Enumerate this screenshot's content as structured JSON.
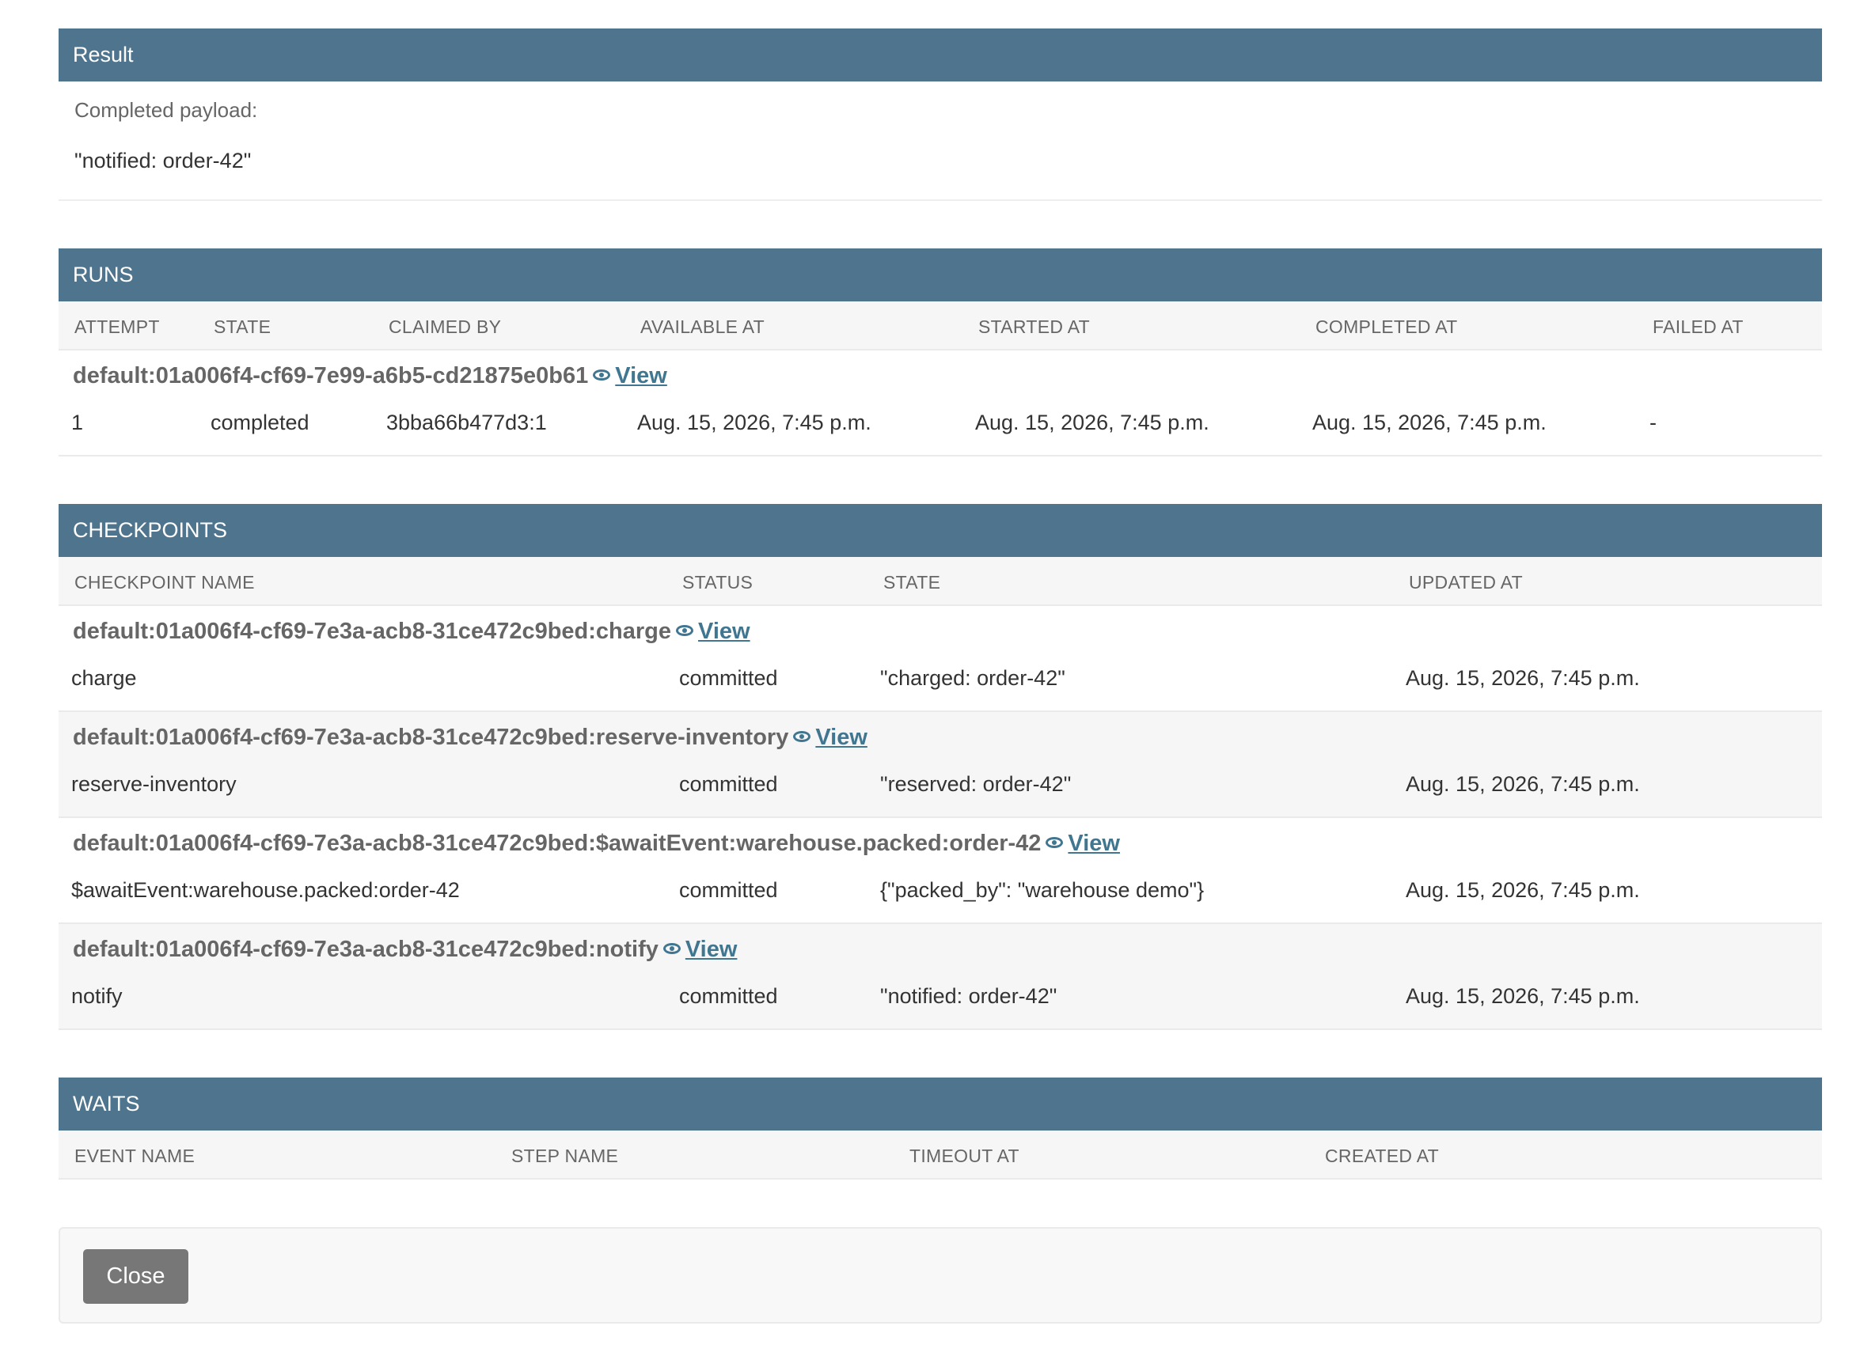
{
  "result": {
    "heading": "Result",
    "label": "Completed payload:",
    "value": "\"notified: order-42\""
  },
  "runs": {
    "heading": "RUNS",
    "columns": [
      "ATTEMPT",
      "STATE",
      "CLAIMED BY",
      "AVAILABLE AT",
      "STARTED AT",
      "COMPLETED AT",
      "FAILED AT"
    ],
    "items": [
      {
        "title": "default:01a006f4-cf69-7e99-a6b5-cd21875e0b61",
        "view_label": "View",
        "attempt": "1",
        "state": "completed",
        "claimed_by": "3bba66b477d3:1",
        "available_at": "Aug. 15, 2026, 7:45 p.m.",
        "started_at": "Aug. 15, 2026, 7:45 p.m.",
        "completed_at": "Aug. 15, 2026, 7:45 p.m.",
        "failed_at": "-"
      }
    ]
  },
  "checkpoints": {
    "heading": "CHECKPOINTS",
    "columns": [
      "CHECKPOINT NAME",
      "STATUS",
      "STATE",
      "UPDATED AT"
    ],
    "items": [
      {
        "title": "default:01a006f4-cf69-7e3a-acb8-31ce472c9bed:charge",
        "view_label": "View",
        "name": "charge",
        "status": "committed",
        "state": "\"charged: order-42\"",
        "updated_at": "Aug. 15, 2026, 7:45 p.m."
      },
      {
        "title": "default:01a006f4-cf69-7e3a-acb8-31ce472c9bed:reserve-inventory",
        "view_label": "View",
        "name": "reserve-inventory",
        "status": "committed",
        "state": "\"reserved: order-42\"",
        "updated_at": "Aug. 15, 2026, 7:45 p.m."
      },
      {
        "title": "default:01a006f4-cf69-7e3a-acb8-31ce472c9bed:$awaitEvent:warehouse.packed:order-42",
        "view_label": "View",
        "name": "$awaitEvent:warehouse.packed:order-42",
        "status": "committed",
        "state": "{\"packed_by\": \"warehouse demo\"}",
        "updated_at": "Aug. 15, 2026, 7:45 p.m."
      },
      {
        "title": "default:01a006f4-cf69-7e3a-acb8-31ce472c9bed:notify",
        "view_label": "View",
        "name": "notify",
        "status": "committed",
        "state": "\"notified: order-42\"",
        "updated_at": "Aug. 15, 2026, 7:45 p.m."
      }
    ]
  },
  "waits": {
    "heading": "WAITS",
    "columns": [
      "EVENT NAME",
      "STEP NAME",
      "TIMEOUT AT",
      "CREATED AT"
    ]
  },
  "footer": {
    "close_label": "Close"
  },
  "colors": {
    "header_bg": "#4f758e",
    "link": "#417690",
    "button_bg": "#777777"
  }
}
